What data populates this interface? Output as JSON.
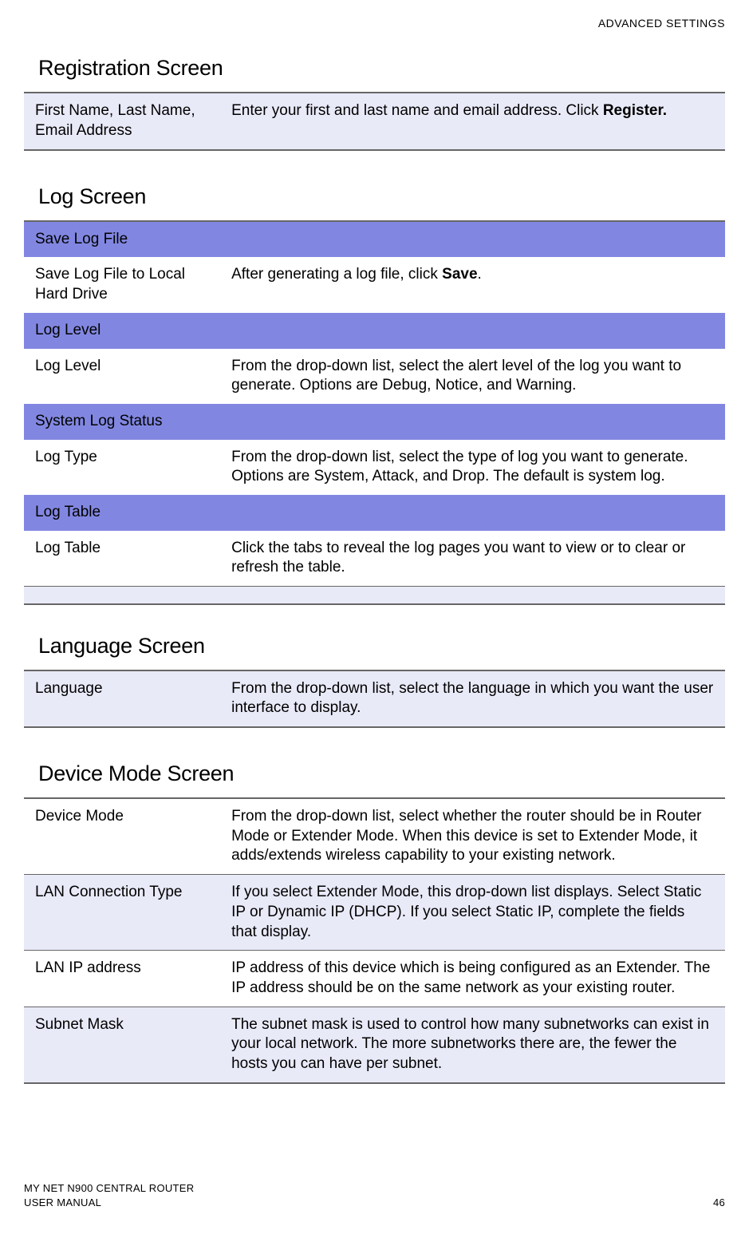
{
  "header": {
    "right": "ADVANCED SETTINGS"
  },
  "registration": {
    "title": "Registration Screen",
    "row1_label": "First Name, Last Name, Email Address",
    "row1_desc_pre": "Enter your first and last name and email address. Click ",
    "row1_desc_bold": "Register."
  },
  "log": {
    "title": "Log Screen",
    "h1": "Save Log File",
    "r1_label": "Save Log File to Local Hard Drive",
    "r1_desc_pre": "After generating a log file, click ",
    "r1_desc_bold": "Save",
    "r1_desc_post": ".",
    "h2": "Log Level",
    "r2_label": "Log Level",
    "r2_desc": "From the drop-down list, select the alert level of the log you want to generate. Options are Debug, Notice, and Warning.",
    "h3": "System Log Status",
    "r3_label": "Log Type",
    "r3_desc": "From the drop-down list, select the type of log you want to generate. Options are System, Attack, and Drop. The default is system log.",
    "h4": "Log Table",
    "r4_label": "Log Table",
    "r4_desc": "Click the tabs to reveal the log pages you want to view or to clear or refresh the table."
  },
  "language": {
    "title": "Language Screen",
    "r1_label": "Language",
    "r1_desc": "From the drop-down list, select the language in which you want the user interface to display."
  },
  "devicemode": {
    "title": "Device Mode Screen",
    "r1_label": "Device Mode",
    "r1_desc": "From the drop-down list, select whether the router should be in Router Mode or Extender Mode. When this device is set to Extender Mode, it adds/extends wireless capability to your existing network.",
    "r2_label": "LAN Connection Type",
    "r2_desc": "If you select Extender Mode, this drop-down list displays. Select Static IP or Dynamic IP (DHCP). If you select Static IP, complete the fields that display.",
    "r3_label": "LAN IP address",
    "r3_desc": "IP address of this device which is being configured as an Extender. The IP address should be on the same network as your existing router.",
    "r4_label": "Subnet Mask",
    "r4_desc": "The subnet mask is used to control how many subnetworks can exist in your local network. The more subnetworks there are, the fewer the hosts you can have per subnet."
  },
  "footer": {
    "line1": "MY NET N900 CENTRAL ROUTER",
    "line2": "USER MANUAL",
    "page": "46"
  }
}
